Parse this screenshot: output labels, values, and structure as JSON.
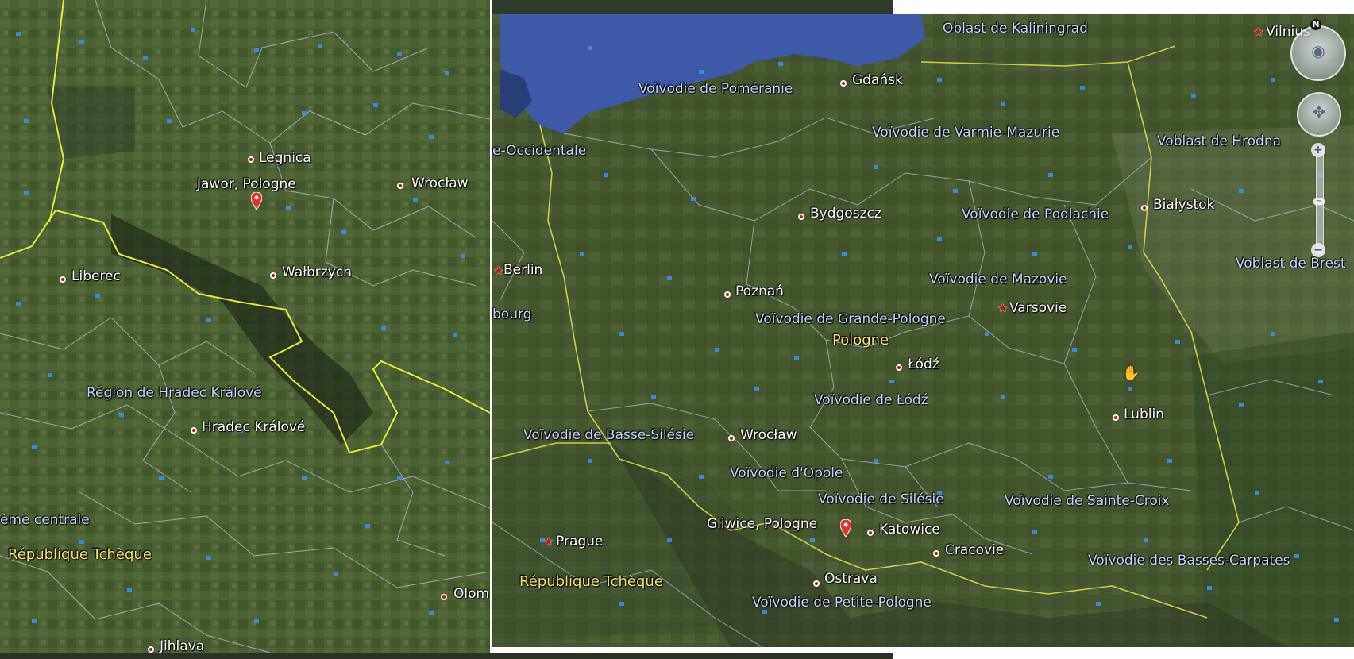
{
  "left_map": {
    "regions": [
      "Région de Hradec Králové",
      "ème centrale"
    ],
    "countries": [
      "République Tchèque"
    ],
    "cities": [
      "Legnica",
      "Wrocław",
      "Liberec",
      "Wałbrzych",
      "Hradec Králové",
      "Olom",
      "Jihlava"
    ],
    "placemark_label": "Jawor, Pologne"
  },
  "right_map": {
    "regions": [
      "Oblast de Kaliningrad",
      "Voïvodie de Poméranie",
      "Voïvodie de Varmie-Mazurie",
      "e-Occidentale",
      "Voblast de Hrodna",
      "Voïvodie de Podlachie",
      "Voïvodie de Mazovie",
      "Voïvodie de Grande-Pologne",
      "Voïvodie de Łódź",
      "Voïvodie de Basse-Silésie",
      "Voïvodie d'Opole",
      "Voïvodie de Silésie",
      "Voïvodie de Sainte-Croix",
      "Voïvodie des Basses-Carpates",
      "Voïvodie de Petite-Pologne",
      "Voblast de Brest",
      "bourg"
    ],
    "countries": [
      "Pologne",
      "République Tchèque"
    ],
    "cities": [
      "Gdańsk",
      "Vilnius",
      "Bydgoszcz",
      "Białystok",
      "Berlin",
      "Poznań",
      "Varsovie",
      "Łódź",
      "Lublin",
      "Wrocław",
      "Katowice",
      "Prague",
      "Cracovie",
      "Ostrava",
      "Łódź"
    ],
    "placemark_label": "Gliwice, Pologne"
  },
  "navigation": {
    "compass_label": "N",
    "zoom_in": "+",
    "zoom_out": "−",
    "zoom_thumb": "−"
  },
  "colors": {
    "sea": "#3d59a8",
    "land": "#4a5e30",
    "border_country": "#e6e640",
    "border_region": "#b8c0d8",
    "region_text": "#c6cff5",
    "country_text": "#f3e07a"
  }
}
